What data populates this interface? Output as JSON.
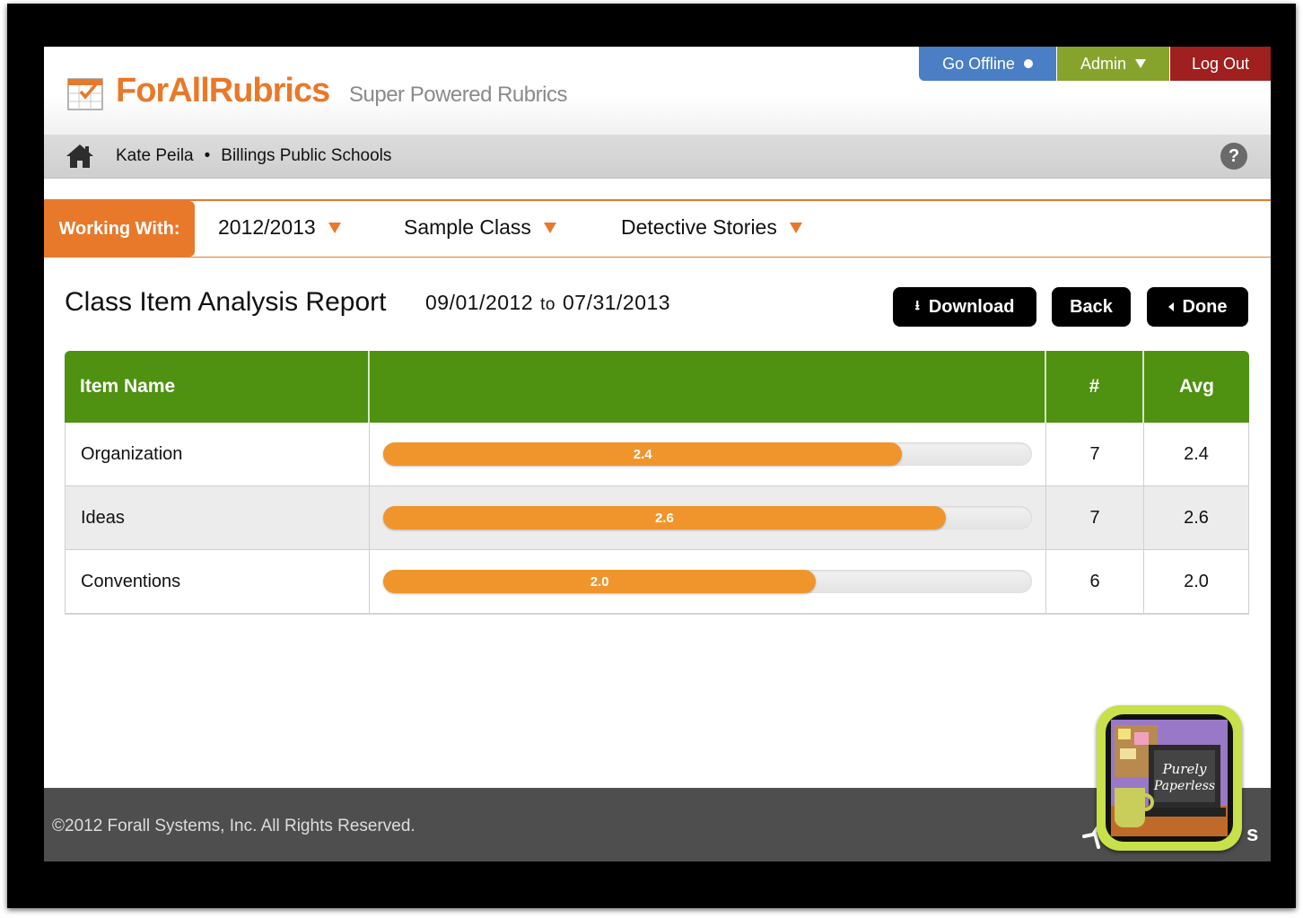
{
  "header": {
    "brand": "ForAllRubrics",
    "tagline": "Super Powered Rubrics",
    "buttons": {
      "offline": "Go Offline",
      "admin": "Admin",
      "logout": "Log Out"
    }
  },
  "userbar": {
    "user": "Kate Peila",
    "separator": "•",
    "org": "Billings Public Schools",
    "help": "?"
  },
  "working_with": {
    "label": "Working With:",
    "year": "2012/2013",
    "class": "Sample Class",
    "assignment": "Detective Stories"
  },
  "report": {
    "title": "Class Item Analysis Report",
    "start_date": "09/01/2012",
    "to": "to",
    "end_date": "07/31/2013",
    "download": "Download",
    "back": "Back",
    "done": "Done"
  },
  "table": {
    "columns": [
      "Item Name",
      "",
      "#",
      "Avg"
    ],
    "max_score": 3.0,
    "rows": [
      {
        "item": "Organization",
        "bar_label": "2.4",
        "bar_fraction": 0.8,
        "count": "7",
        "avg": "2.4"
      },
      {
        "item": "Ideas",
        "bar_label": "2.6",
        "bar_fraction": 0.867,
        "count": "7",
        "avg": "2.6"
      },
      {
        "item": "Conventions",
        "bar_label": "2.0",
        "bar_fraction": 0.667,
        "count": "6",
        "avg": "2.0"
      }
    ]
  },
  "footer": {
    "copyright": "©2012 Forall Systems, Inc. All Rights Reserved.",
    "trailing_text": "s"
  },
  "badge": {
    "line1": "Purely",
    "line2": "Paperless"
  },
  "colors": {
    "brand_orange": "#e8792a",
    "table_green": "#4f9111",
    "bar_orange": "#f0952c",
    "offline_blue": "#4a7ec5",
    "admin_green": "#86a32c",
    "logout_red": "#a01f1f"
  },
  "icons": {
    "logo": "calendar-check-icon",
    "home": "home-icon",
    "help": "help-icon",
    "download": "download-icon",
    "done": "chevron-left-icon"
  }
}
